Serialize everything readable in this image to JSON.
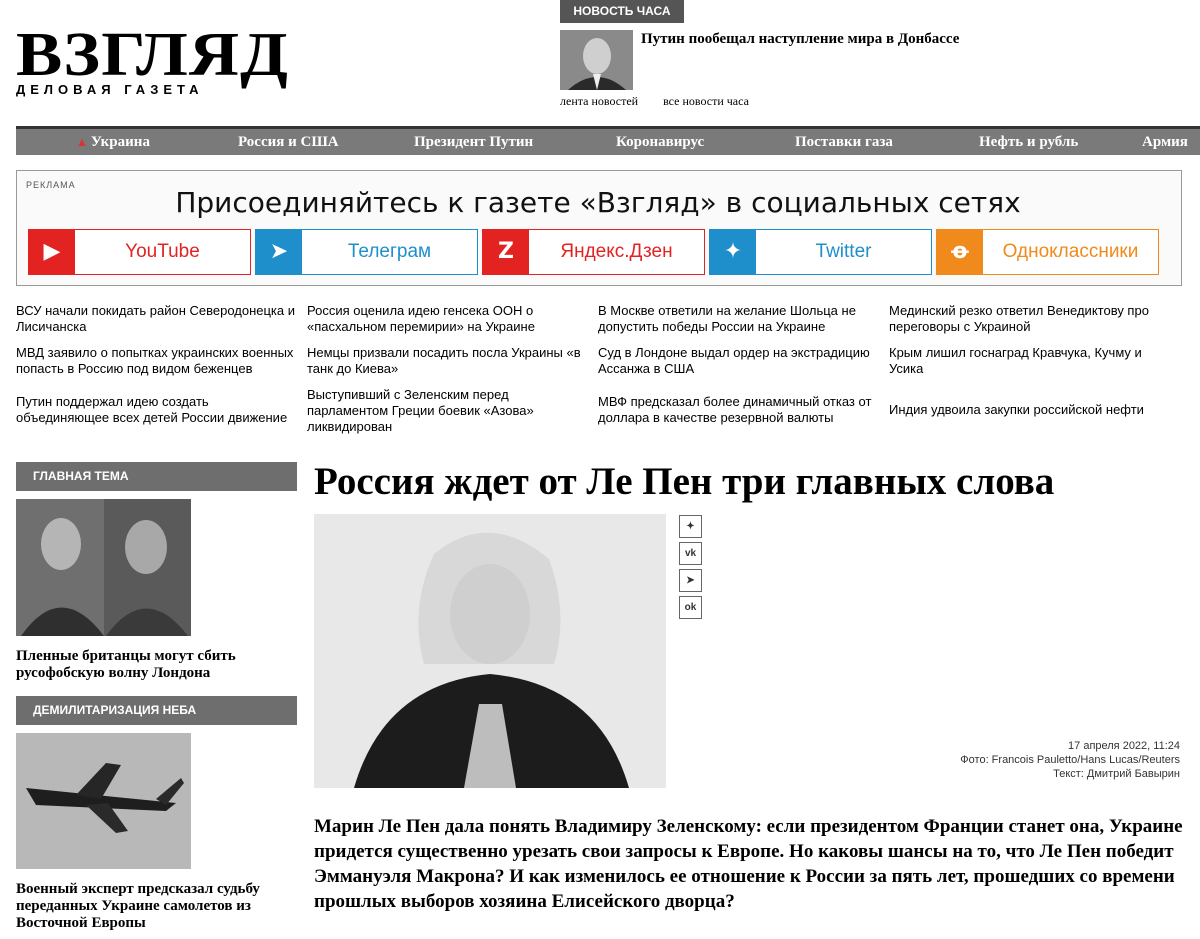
{
  "logo": {
    "title": "ВЗГЛЯД",
    "subtitle": "ДЕЛОВАЯ ГАЗЕТА"
  },
  "hot_news": {
    "tag": "НОВОСТЬ ЧАСА",
    "title": "Путин пообещал наступление мира в Донбассе",
    "links": [
      "лента новостей",
      "все новости часа"
    ]
  },
  "nav": [
    "Украина",
    "Россия и США",
    "Президент Путин",
    "Коронавирус",
    "Поставки газа",
    "Нефть и рубль",
    "Армия и"
  ],
  "ad": {
    "tag": "РЕКЛАМА",
    "title": "Присоединяйтесь к газете «Взгляд» в социальных сетях",
    "buttons": [
      {
        "label": "YouTube",
        "icon": "youtube-icon",
        "color": "#e32222"
      },
      {
        "label": "Телеграм",
        "icon": "telegram-icon",
        "color": "#1f8fcc"
      },
      {
        "label": "Яндекс.Дзен",
        "icon": "zen-icon",
        "color": "#e32222"
      },
      {
        "label": "Twitter",
        "icon": "twitter-icon",
        "color": "#1f8fcc"
      },
      {
        "label": "Одноклассники",
        "icon": "ok-icon",
        "color": "#f08a1c"
      }
    ]
  },
  "news": [
    [
      "ВСУ начали покидать район Северодонецка и Лисичанска",
      "МВД заявило о попытках украинских военных попасть в Россию под видом беженцев",
      "Путин поддержал идею создать объединяющее всех детей России движение"
    ],
    [
      "Россия оценила идею генсека ООН о «пасхальном перемирии» на Украине",
      "Немцы призвали посадить посла Украины «в танк до Киева»",
      "Выступивший с Зеленским перед парламентом Греции боевик «Азова» ликвидирован"
    ],
    [
      "В Москве ответили на желание Шольца не допустить победы России на Украине",
      "Суд в Лондоне выдал ордер на экстрадицию Ассанжа в США",
      "МВФ предсказал более динамичный отказ от доллара в качестве резервной валюты"
    ],
    [
      "Мединский резко ответил Венедиктову про переговоры с Украиной",
      "Крым лишил госнаград Кравчука, Кучму и Усика",
      "Индия удвоила закупки российской нефти"
    ]
  ],
  "sidebar": [
    {
      "tag": "ГЛАВНАЯ ТЕМА",
      "caption": "Пленные британцы могут сбить русофобскую волну Лондона"
    },
    {
      "tag": "ДЕМИЛИТАРИЗАЦИЯ НЕБА",
      "caption": "Военный эксперт предсказал судьбу переданных Украине самолетов из Восточной Европы"
    }
  ],
  "article": {
    "headline": "Россия ждет от Ле Пен три главных слова",
    "date": "17 апреля 2022, 11:24",
    "photo_credit": "Фото: Francois Pauletto/Hans Lucas/Reuters",
    "author": "Текст: Дмитрий Бавырин",
    "lead": "Марин Ле Пен дала понять Владимиру Зеленскому: если президентом Франции станет она, Украине придется существенно урезать свои запросы к Европе. Но каковы шансы на то, что Ле Пен победит Эммануэля Макрона? И как изменилось ее отношение к России за пять лет, прошедших со времени прошлых выборов хозяина Елисейского дворца?"
  },
  "share_icons": [
    "twitter-share-icon",
    "vk-share-icon",
    "telegram-share-icon",
    "ok-share-icon"
  ]
}
